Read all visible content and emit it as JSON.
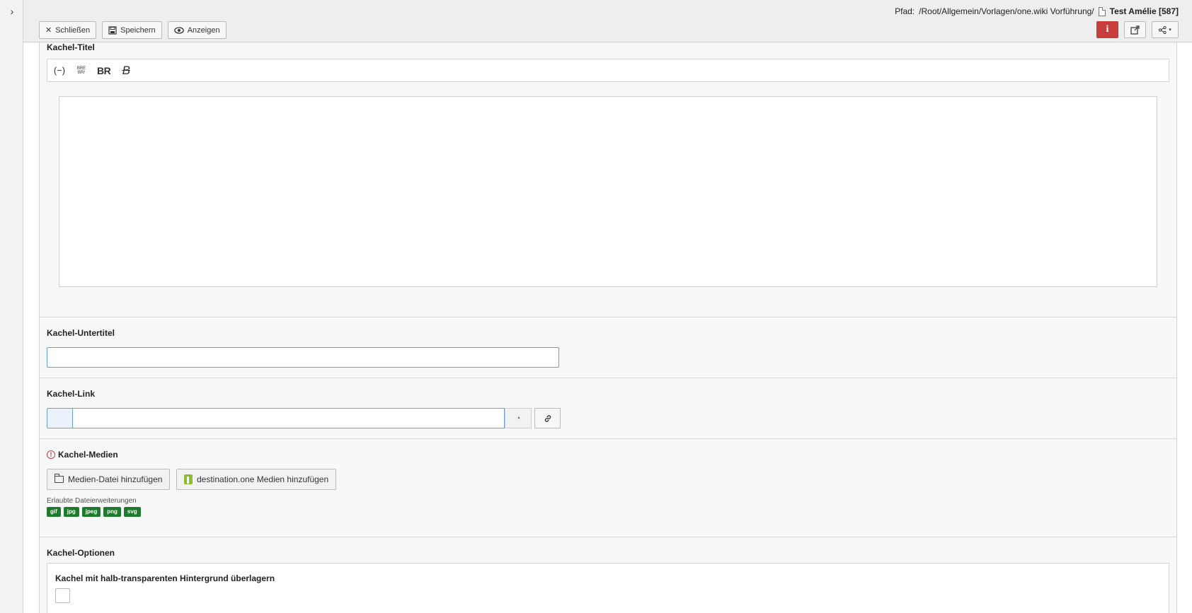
{
  "header": {
    "path_label": "Pfad:",
    "path": "/Root/Allgemein/Vorlagen/one.wiki Vorführung/",
    "page_title": "Test Amélie [587]",
    "buttons": {
      "close": "Schließen",
      "save": "Speichern",
      "view": "Anzeigen"
    },
    "info_symbol": "i"
  },
  "sections": {
    "title": {
      "label": "Kachel-Titel",
      "toolbar": [
        "(−)",
        "BR",
        "B"
      ]
    },
    "subtitle": {
      "label": "Kachel-Untertitel",
      "value": ""
    },
    "link": {
      "label": "Kachel-Link",
      "value": ""
    },
    "media": {
      "label": "Kachel-Medien",
      "error_symbol": "!",
      "add_file": "Medien-Datei hinzufügen",
      "add_d1": "destination.one Medien hinzufügen",
      "allowed_label": "Erlaubte Dateierweiterungen",
      "extensions": [
        "gif",
        "jpg",
        "jpeg",
        "png",
        "svg"
      ]
    },
    "options": {
      "label": "Kachel-Optionen",
      "overlay_label": "Kachel mit halb-transparenten Hintergrund überlagern"
    }
  },
  "colors": {
    "info_button": "#c83c3c",
    "extension_badge": "#1e7b2c",
    "input_border": "#6aa0d8"
  }
}
